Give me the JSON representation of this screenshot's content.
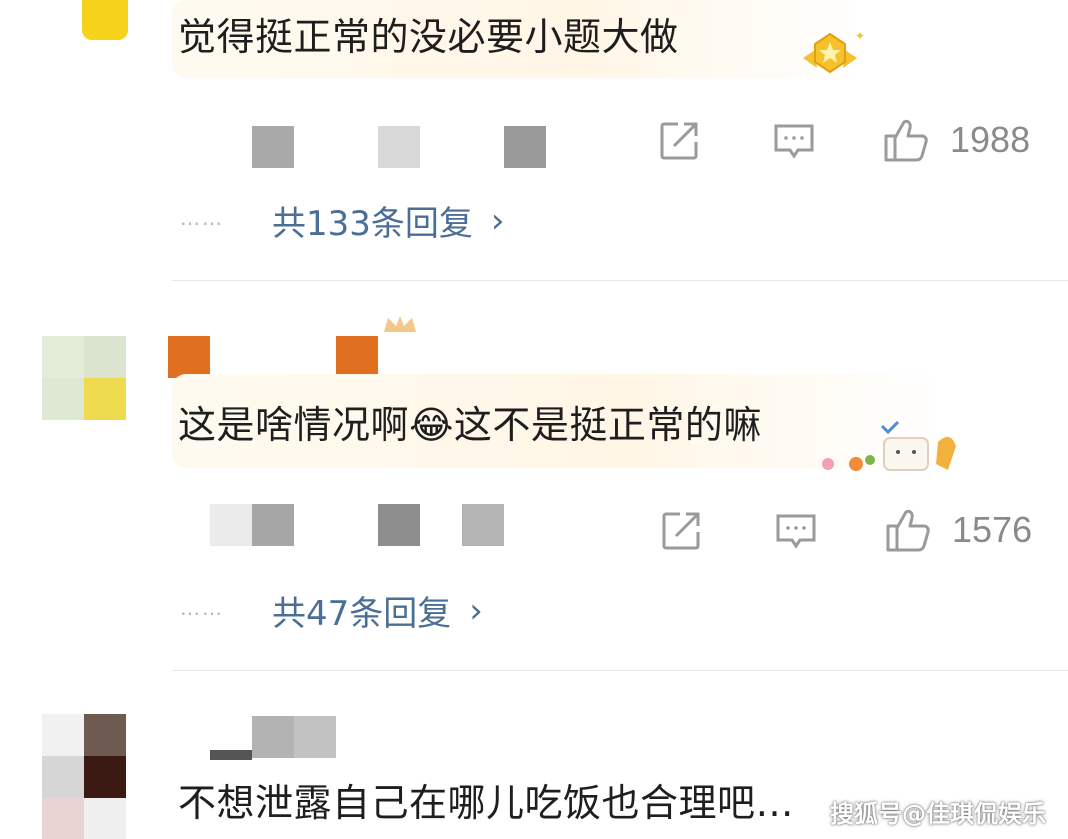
{
  "comments": [
    {
      "text": "觉得挺正常的没必要小题大做",
      "likes": "1988",
      "replies_label": "共133条回复",
      "badge": "gold-star-badge-icon"
    },
    {
      "text": "这是啥情况啊😂这不是挺正常的嘛",
      "likes": "1576",
      "replies_label": "共47条回复",
      "badge": "cartoon-sticker-icon"
    },
    {
      "text": "不想泄露自己在哪儿吃饭也合理吧…"
    }
  ],
  "ui": {
    "ellipsis": "……",
    "chevron": "›"
  },
  "watermark": "搜狐号@佳琪侃娱乐",
  "colors": {
    "reply_link": "#4a6e96",
    "icon_gray": "#9a9a9a",
    "divider": "#e6e6e6"
  }
}
